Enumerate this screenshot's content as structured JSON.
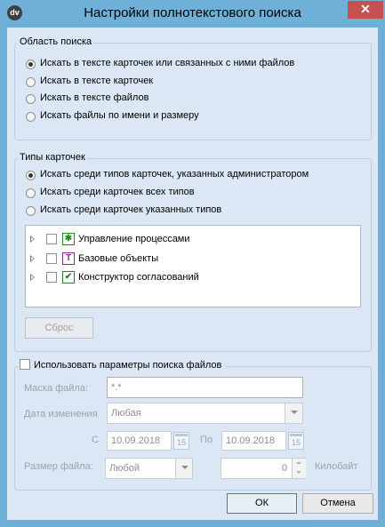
{
  "window": {
    "app_icon": "dv",
    "title": "Настройки полнотекстового поиска",
    "close_glyph": "✕"
  },
  "search_area": {
    "label": "Область поиска",
    "options": [
      {
        "label": "Искать в тексте карточек или связанных с ними файлов",
        "selected": true
      },
      {
        "label": "Искать в тексте карточек",
        "selected": false
      },
      {
        "label": "Искать в тексте файлов",
        "selected": false
      },
      {
        "label": "Искать файлы по имени и размеру",
        "selected": false
      }
    ]
  },
  "card_types": {
    "label": "Типы карточек",
    "options": [
      {
        "label": "Искать среди типов карточек, указанных администратором",
        "selected": true
      },
      {
        "label": "Искать среди карточек всех типов",
        "selected": false
      },
      {
        "label": "Искать среди карточек указанных типов",
        "selected": false
      }
    ],
    "tree": [
      {
        "label": "Управление процессами",
        "icon": "process-management-icon",
        "color": "#1a8f1a"
      },
      {
        "label": "Базовые объекты",
        "icon": "base-objects-icon",
        "color": "#8a2a8a"
      },
      {
        "label": "Конструктор согласований",
        "icon": "approval-designer-icon",
        "color": "#2e7d32"
      }
    ],
    "reset_label": "Сброс"
  },
  "file_search": {
    "checkbox_label": "Использовать параметры поиска файлов",
    "mask_label": "Маска файла:",
    "mask_value": "*.*",
    "date_label": "Дата изменения",
    "date_value": "Любая",
    "from_label": "С",
    "from_value": "10.09.2018",
    "to_label": "По",
    "to_value": "10.09.2018",
    "calendar_day": "15",
    "size_label": "Размер файла:",
    "size_value": "Любой",
    "size_number": "0",
    "size_unit": "Килобайт"
  },
  "buttons": {
    "ok": "ОК",
    "cancel": "Отмена"
  }
}
